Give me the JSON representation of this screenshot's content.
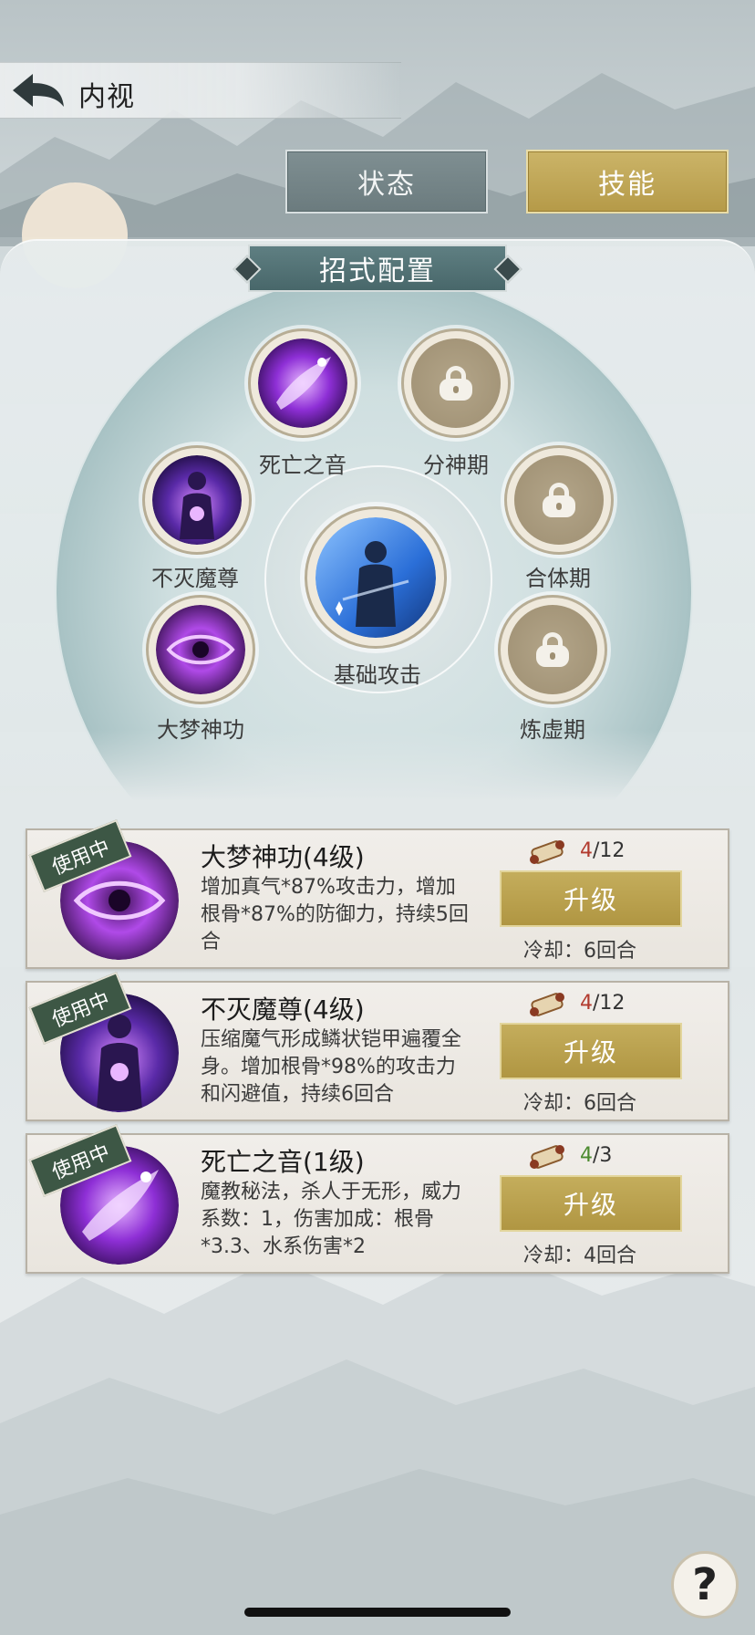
{
  "header": {
    "title": "内视",
    "back_icon": "back-arrow-icon"
  },
  "tabs": [
    {
      "label": "状态",
      "active": false
    },
    {
      "label": "技能",
      "active": true
    }
  ],
  "config": {
    "banner": "招式配置",
    "slots": [
      {
        "label": "死亡之音",
        "state": "equipped",
        "icon": "death-sound-icon"
      },
      {
        "label": "分神期",
        "state": "locked",
        "icon": "lock-icon"
      },
      {
        "label": "不灭魔尊",
        "state": "equipped",
        "icon": "demon-lord-icon"
      },
      {
        "label": "合体期",
        "state": "locked",
        "icon": "lock-icon"
      },
      {
        "label": "基础攻击",
        "state": "equipped",
        "icon": "basic-attack-icon"
      },
      {
        "label": "大梦神功",
        "state": "equipped",
        "icon": "dream-eye-icon"
      },
      {
        "label": "炼虚期",
        "state": "locked",
        "icon": "lock-icon"
      }
    ]
  },
  "skills": [
    {
      "badge": "使用中",
      "name": "大梦神功(4级)",
      "desc": "增加真气*87%攻击力，增加根骨*87%的防御力，持续5回合",
      "count_current": "4",
      "count_total": "/12",
      "count_color": "red",
      "upgrade": "升级",
      "cooldown": "冷却：6回合"
    },
    {
      "badge": "使用中",
      "name": "不灭魔尊(4级)",
      "desc": "压缩魔气形成鳞状铠甲遍覆全身。增加根骨*98%的攻击力和闪避值，持续6回合",
      "count_current": "4",
      "count_total": "/12",
      "count_color": "red",
      "upgrade": "升级",
      "cooldown": "冷却：6回合"
    },
    {
      "badge": "使用中",
      "name": "死亡之音(1级)",
      "desc": "魔教秘法，杀人于无形，威力系数：1，伤害加成：根骨*3.3、水系伤害*2",
      "count_current": "4",
      "count_total": "/3",
      "count_color": "green",
      "upgrade": "升级",
      "cooldown": "冷却：4回合"
    }
  ],
  "help": "?"
}
